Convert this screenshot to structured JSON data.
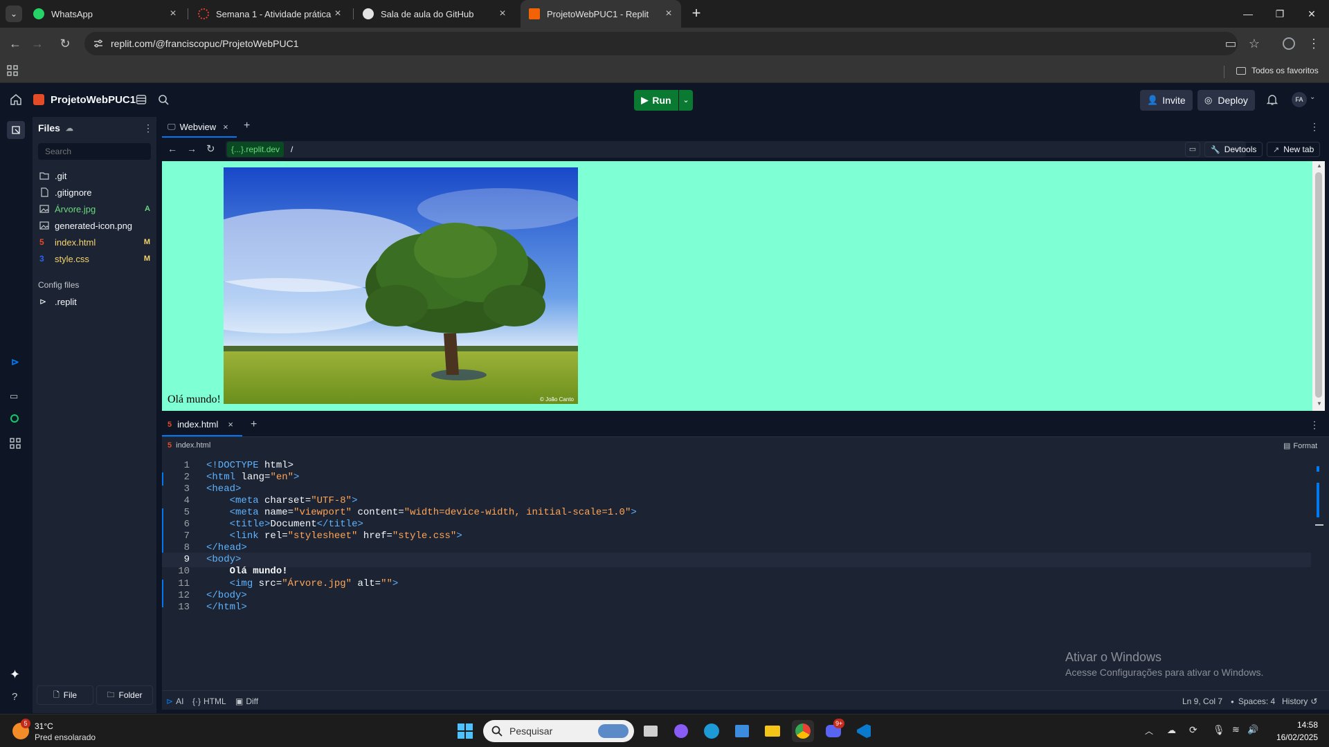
{
  "browser": {
    "tabs": [
      {
        "title": "WhatsApp",
        "favicon_color": "#25d366",
        "favicon": "whatsapp-icon"
      },
      {
        "title": "Semana 1 - Atividade prática",
        "favicon_color": "#e03e2f",
        "favicon": "spinner-icon"
      },
      {
        "title": "Sala de aula do GitHub",
        "favicon_color": "#e3e3e3",
        "favicon": "github-icon"
      },
      {
        "title": "ProjetoWebPUC1 - Replit",
        "favicon_color": "#f26207",
        "favicon": "replit-icon",
        "active": true
      }
    ],
    "url": "replit.com/@franciscopuc/ProjetoWebPUC1",
    "bookmarks_folder": "Todos os favoritos"
  },
  "replit": {
    "project_name": "ProjetoWebPUC1",
    "run_label": "Run",
    "invite_label": "Invite",
    "deploy_label": "Deploy",
    "avatar_initials": "FA",
    "accent_green": "#0cce6b",
    "files": {
      "title": "Files",
      "search_placeholder": "Search",
      "items": [
        {
          "name": ".git",
          "icon": "folder-icon",
          "badge": "",
          "color": "#f5f9fc"
        },
        {
          "name": ".gitignore",
          "icon": "file-icon",
          "badge": "",
          "color": "#f5f9fc"
        },
        {
          "name": "Árvore.jpg",
          "icon": "image-icon",
          "badge": "A",
          "color": "#6cd97e"
        },
        {
          "name": "generated-icon.png",
          "icon": "image-icon",
          "badge": "",
          "color": "#f5f9fc"
        },
        {
          "name": "index.html",
          "icon": "html-icon",
          "badge": "M",
          "color": "#f5d66c"
        },
        {
          "name": "style.css",
          "icon": "css-icon",
          "badge": "M",
          "color": "#f5d66c"
        }
      ],
      "config_title": "Config files",
      "config_items": [
        {
          "name": ".replit",
          "icon": "replit-file-icon"
        }
      ],
      "new_file_label": "File",
      "new_folder_label": "Folder"
    },
    "webview": {
      "tab_label": "Webview",
      "domain": "{...}.replit.dev",
      "path": "/",
      "devtools_label": "Devtools",
      "newtab_label": "New tab",
      "page_text": "Olá mundo!",
      "background": "#7fffd4",
      "image_credit": "© João Canto"
    },
    "editor": {
      "tab_label": "index.html",
      "breadcrumb": "index.html",
      "format_label": "Format",
      "current_line": 9,
      "lines": [
        "<!DOCTYPE html>",
        "<html lang=\"en\">",
        "<head>",
        "    <meta charset=\"UTF-8\">",
        "    <meta name=\"viewport\" content=\"width=device-width, initial-scale=1.0\">",
        "    <title>Document</title>",
        "    <link rel=\"stylesheet\" href=\"style.css\">",
        "</head>",
        "<body>",
        "    Olá mundo!",
        "    <img src=\"Árvore.jpg\" alt=\"\">",
        "</body>",
        "</html>"
      ]
    },
    "status": {
      "ai": "AI",
      "lang": "HTML",
      "diff": "Diff",
      "position": "Ln 9, Col 7",
      "spaces": "Spaces: 4",
      "history": "History"
    },
    "watermark": {
      "title": "Ativar o Windows",
      "subtitle": "Acesse Configurações para ativar o Windows."
    }
  },
  "taskbar": {
    "weather_temp": "31°C",
    "weather_desc": "Pred ensolarado",
    "weather_badge": "5",
    "search_placeholder": "Pesquisar",
    "time": "14:58",
    "date": "16/02/2025",
    "discord_badge": "9+"
  }
}
